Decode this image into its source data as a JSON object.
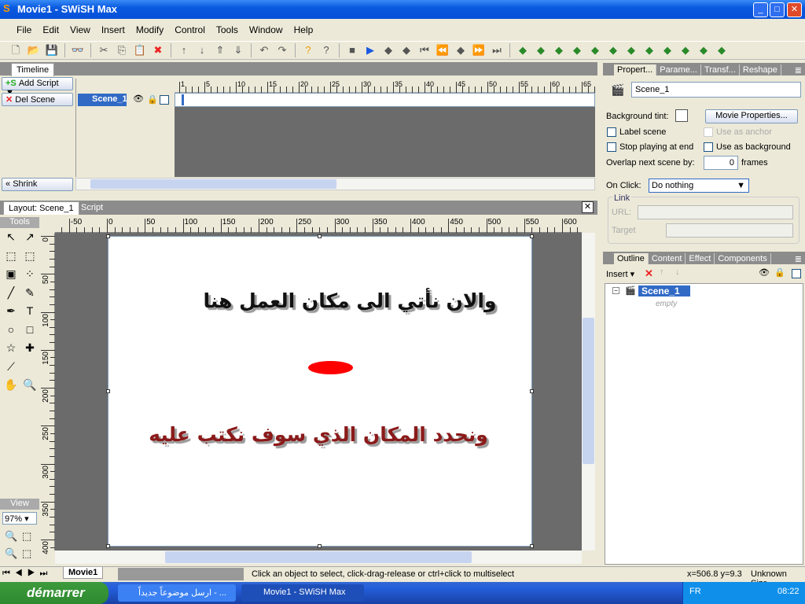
{
  "window": {
    "title": "Movie1 - SWiSH Max",
    "minimize": "_",
    "maximize": "□",
    "close": "✕"
  },
  "menu": [
    "File",
    "Edit",
    "View",
    "Insert",
    "Modify",
    "Control",
    "Tools",
    "Window",
    "Help"
  ],
  "toolbar_icons": [
    "new-file-icon",
    "open-folder-icon",
    "save-icon",
    "preview-icon",
    "cut-icon",
    "copy-icon",
    "paste-icon",
    "delete-icon",
    "move-up-icon",
    "move-down-icon",
    "move-top-icon",
    "move-bottom-icon",
    "undo-icon",
    "redo-icon",
    "help-icon",
    "context-help-icon",
    "stop-icon",
    "play-icon",
    "play-scene-icon",
    "play-effect-icon",
    "first-frame-icon",
    "prev-frame-icon",
    "next-keyframe-icon",
    "next-frame-icon",
    "last-frame-icon",
    "insert-scene-icon",
    "insert-sprite-icon",
    "insert-text-icon",
    "insert-button-icon",
    "insert-image-icon",
    "insert-sound-icon",
    "insert-effect-icon",
    "insert-script-icon",
    "insert-component-icon",
    "insert-content-icon",
    "insert-action-icon",
    "insert-flag-icon"
  ],
  "timeline": {
    "tab": "Timeline",
    "add_script": "Add Script",
    "del_scene": "Del Scene",
    "shrink": "Shrink",
    "scene": "Scene_1",
    "ruler": [
      "1",
      "5",
      "10",
      "15",
      "20",
      "25",
      "30",
      "35",
      "40",
      "45",
      "50",
      "55",
      "60",
      "65"
    ]
  },
  "layout": {
    "tabs": [
      "Layout: Scene_1",
      "Script"
    ],
    "tools_label": "Tools",
    "view_label": "View",
    "zoom": "97%",
    "top_ruler": [
      "-50",
      "0",
      "50",
      "100",
      "150",
      "200",
      "250",
      "300",
      "350",
      "400",
      "450",
      "500",
      "550",
      "600"
    ],
    "left_ruler": [
      "0",
      "50",
      "100",
      "150",
      "200",
      "250",
      "300",
      "350",
      "400"
    ]
  },
  "stage": {
    "text1": "والان نأتي الى مكان العمل هنا",
    "text2": "ونحدد المكان الذي سوف نكتب عليه",
    "text1_color": "#111111",
    "text2_color": "#8b1a1a",
    "ellipse_color": "#ff0000"
  },
  "properties": {
    "tabs": [
      "Propert...",
      "Parame...",
      "Transf...",
      "Reshape"
    ],
    "name": "Scene_1",
    "bg_tint": "Background tint:",
    "movie_props": "Movie Properties...",
    "label_scene": "Label scene",
    "use_anchor": "Use as anchor",
    "stop_end": "Stop playing at end",
    "use_bg": "Use as background",
    "overlap": "Overlap next scene by:",
    "overlap_value": "0",
    "frames": "frames",
    "onclick": "On Click:",
    "onclick_value": "Do nothing",
    "link": "Link",
    "url": "URL:",
    "target": "Target"
  },
  "outline": {
    "tabs": [
      "Outline",
      "Content",
      "Effect",
      "Components"
    ],
    "insert": "Insert",
    "scene": "Scene_1",
    "empty": "empty"
  },
  "bottom": {
    "movie_tab": "Movie1",
    "status": "Click an object to select, click-drag-release or ctrl+click to multiselect",
    "coords": "x=506.8 y=9.3",
    "size": "Unknown Size"
  },
  "taskbar": {
    "start": "démarrer",
    "tasks": [
      "ارسل موضوعاً جديداً - ...",
      "Movie1 - SWiSH Max"
    ],
    "lang": "FR",
    "clock": "08:22"
  }
}
